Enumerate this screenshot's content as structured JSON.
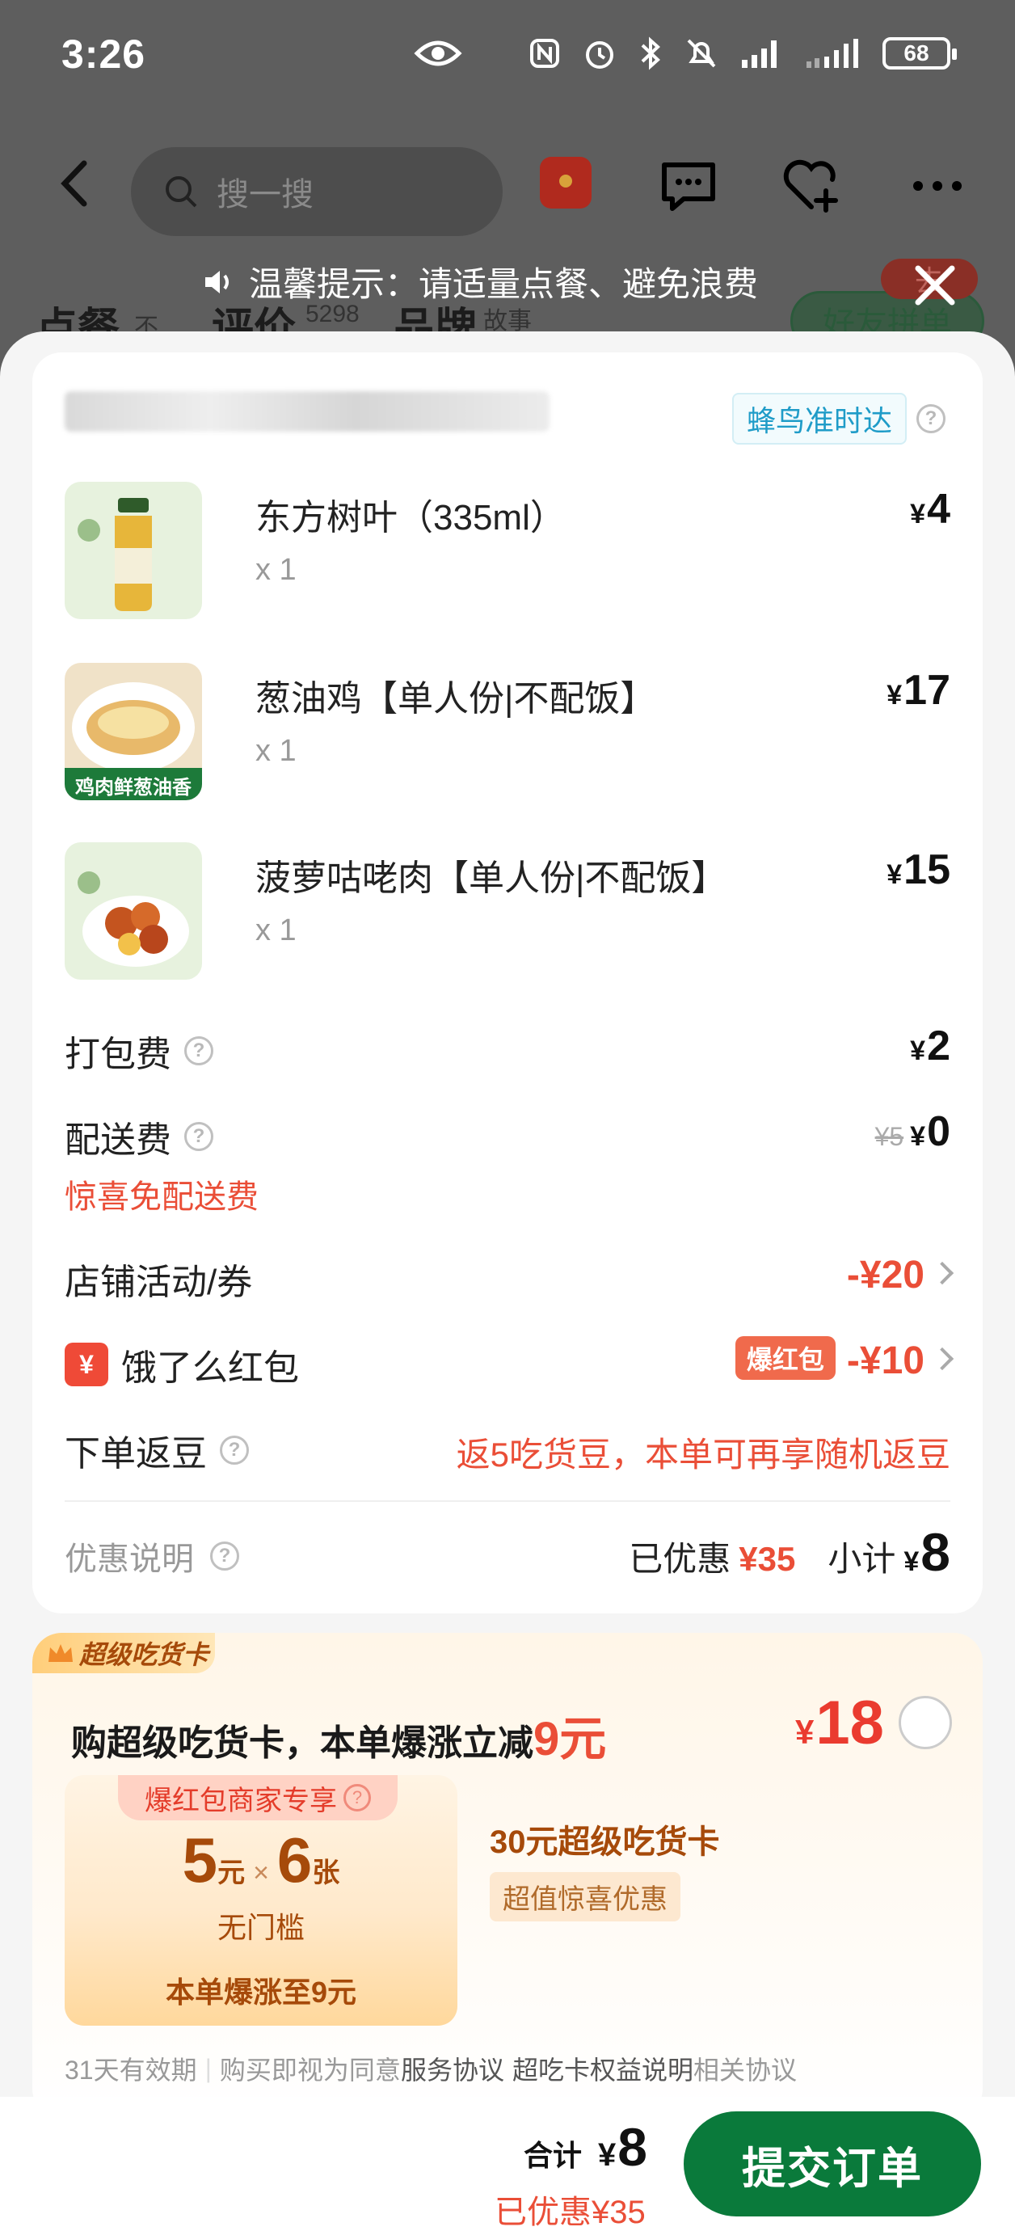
{
  "status": {
    "time": "3:26",
    "battery": "68"
  },
  "topbar": {
    "search_placeholder": "搜一搜"
  },
  "background_tabs": {
    "order": "点餐",
    "order_sub": "不",
    "reviews": "评价",
    "reviews_count": "5298",
    "brand": "品牌",
    "brand_sub": "故事",
    "friends": "好友拼单",
    "go_tag": "去"
  },
  "tip": {
    "text": "温馨提示：请适量点餐、避免浪费"
  },
  "order": {
    "delivery_badge": "蜂鸟准时达",
    "items": [
      {
        "name": "东方树叶（335ml）",
        "qty": "x 1",
        "price": "4"
      },
      {
        "name": "葱油鸡【单人份|不配饭】",
        "qty": "x 1",
        "price": "17",
        "thumb_label": "鸡肉鲜葱油香"
      },
      {
        "name": "菠萝咕咾肉【单人份|不配饭】",
        "qty": "x 1",
        "price": "15"
      }
    ],
    "packing": {
      "label": "打包费",
      "value": "2"
    },
    "delivery": {
      "label": "配送费",
      "original": "¥5",
      "value": "0",
      "note": "惊喜免配送费"
    },
    "shop_promo": {
      "label": "店铺活动/券",
      "value": "-¥20"
    },
    "red_packet": {
      "icon": "¥",
      "label": "饿了么红包",
      "tag": "爆红包",
      "value": "-¥10"
    },
    "beans": {
      "label": "下单返豆",
      "value": "返5吃货豆，本单可再享随机返豆"
    },
    "summary": {
      "label": "优惠说明",
      "saved_label": "已优惠",
      "saved": "¥35",
      "subtotal_label": "小计",
      "subtotal": "8"
    }
  },
  "super_card": {
    "tag": "超级吃货卡",
    "title_prefix": "购超级吃货卡，本单爆涨立减",
    "title_amount": "9元",
    "price": "18",
    "coupon_head": "爆红包商家专享",
    "coupon_value": "5",
    "coupon_unit": "元",
    "coupon_x": "×",
    "coupon_count": "6",
    "coupon_count_unit": "张",
    "coupon_sub": "无门槛",
    "coupon_foot": "本单爆涨至9元",
    "card_name": "30元超级吃货卡",
    "card_tag": "超值惊喜优惠",
    "foot_validity": "31天有效期",
    "foot_agree": "购买即视为同意",
    "foot_service": "服务协议",
    "foot_rights": "超吃卡权益说明",
    "foot_related": "相关协议"
  },
  "bottom": {
    "total_label": "合计",
    "total": "8",
    "saved": "已优惠¥35",
    "submit": "提交订单"
  },
  "colors": {
    "accent_green": "#0a7a3b",
    "price_red": "#ea4e37"
  }
}
